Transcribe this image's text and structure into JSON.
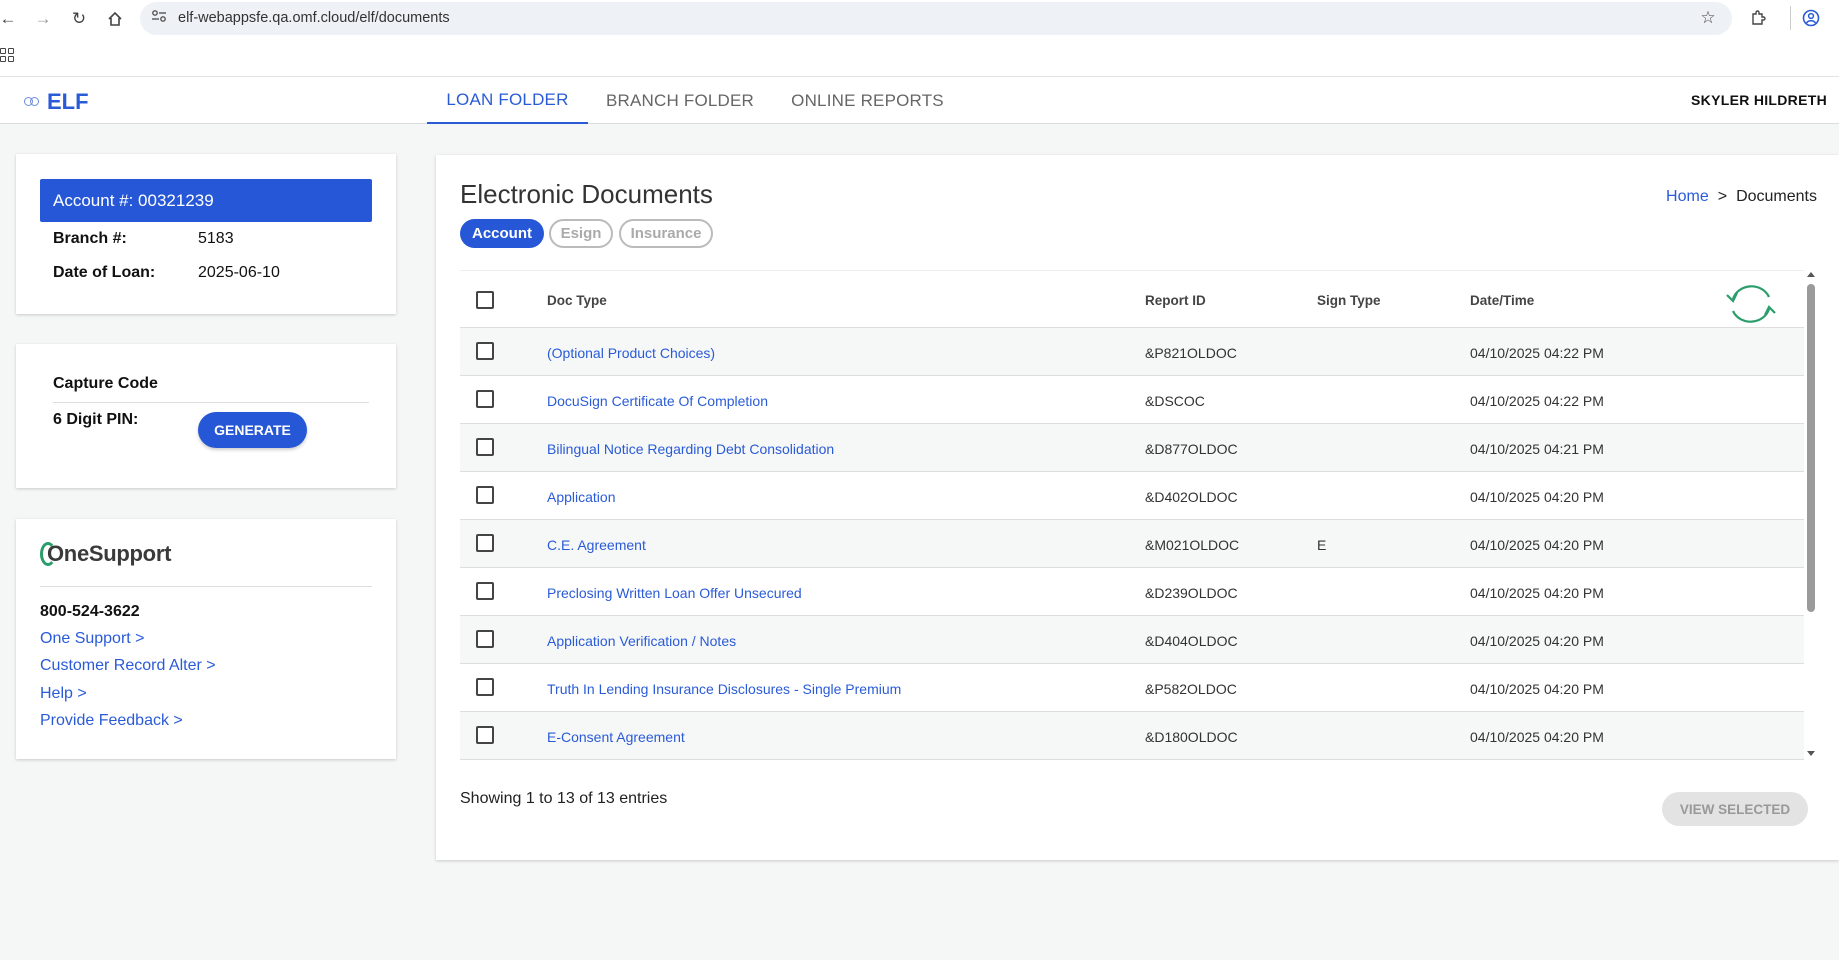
{
  "browser": {
    "url": "elf-webappsfe.qa.omf.cloud/elf/documents"
  },
  "header": {
    "logo": "ELF",
    "tabs": [
      {
        "label": "LOAN FOLDER"
      },
      {
        "label": "BRANCH FOLDER"
      },
      {
        "label": "ONLINE REPORTS"
      }
    ],
    "user": "SKYLER HILDRETH"
  },
  "account_card": {
    "account_label": "Account #: 00321239",
    "branch_label": "Branch #:",
    "branch_value": "5183",
    "date_label": "Date of Loan:",
    "date_value": "2025-06-10"
  },
  "capture_card": {
    "title": "Capture Code",
    "pin_label": "6 Digit PIN:",
    "generate_label": "GENERATE"
  },
  "support_card": {
    "logo": "OneSupport",
    "phone": "800-524-3622",
    "links": [
      {
        "label": "One Support >"
      },
      {
        "label": "Customer Record Alter >"
      },
      {
        "label": "Help >"
      },
      {
        "label": "Provide Feedback >"
      }
    ]
  },
  "main": {
    "title": "Electronic Documents",
    "breadcrumb": {
      "home": "Home",
      "separator": ">",
      "current": "Documents"
    },
    "chips": [
      {
        "label": "Account"
      },
      {
        "label": "Esign"
      },
      {
        "label": "Insurance"
      }
    ],
    "columns": {
      "doc_type": "Doc Type",
      "report_id": "Report ID",
      "sign_type": "Sign Type",
      "date_time": "Date/Time"
    },
    "rows": [
      {
        "doc_type": "(Optional Product Choices)",
        "report_id": "&P821OLDOC",
        "sign_type": "",
        "date_time": "04/10/2025 04:22 PM"
      },
      {
        "doc_type": "DocuSign Certificate Of Completion",
        "report_id": "&DSCOC",
        "sign_type": "",
        "date_time": "04/10/2025 04:22 PM"
      },
      {
        "doc_type": "Bilingual Notice Regarding Debt Consolidation",
        "report_id": "&D877OLDOC",
        "sign_type": "",
        "date_time": "04/10/2025 04:21 PM"
      },
      {
        "doc_type": "Application",
        "report_id": "&D402OLDOC",
        "sign_type": "",
        "date_time": "04/10/2025 04:20 PM"
      },
      {
        "doc_type": "C.E. Agreement",
        "report_id": "&M021OLDOC",
        "sign_type": "E",
        "date_time": "04/10/2025 04:20 PM"
      },
      {
        "doc_type": "Preclosing Written Loan Offer Unsecured",
        "report_id": "&D239OLDOC",
        "sign_type": "",
        "date_time": "04/10/2025 04:20 PM"
      },
      {
        "doc_type": "Application Verification / Notes",
        "report_id": "&D404OLDOC",
        "sign_type": "",
        "date_time": "04/10/2025 04:20 PM"
      },
      {
        "doc_type": "Truth In Lending Insurance Disclosures - Single Premium",
        "report_id": "&P582OLDOC",
        "sign_type": "",
        "date_time": "04/10/2025 04:20 PM"
      },
      {
        "doc_type": "E-Consent Agreement",
        "report_id": "&D180OLDOC",
        "sign_type": "",
        "date_time": "04/10/2025 04:20 PM"
      }
    ],
    "showing": "Showing 1 to 13 of 13 entries",
    "view_selected_label": "VIEW SELECTED"
  },
  "colors": {
    "primary": "#2657d6",
    "link": "#2a5bd7",
    "refresh": "#2a9d6b"
  }
}
